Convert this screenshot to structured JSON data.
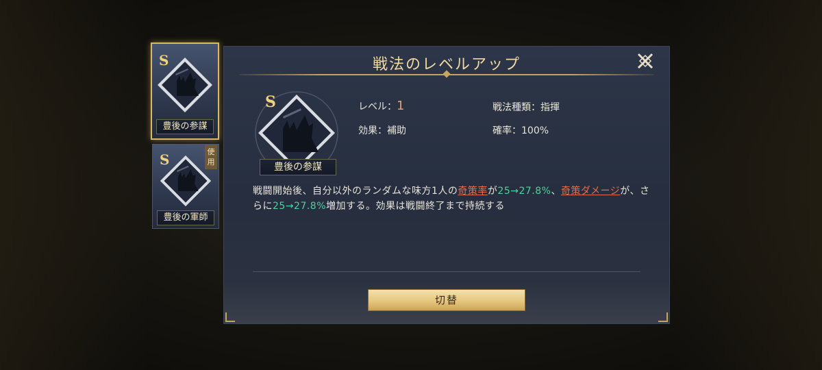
{
  "skill_list": [
    {
      "rank": "S",
      "name": "豊後の参謀",
      "selected": true,
      "badge": ""
    },
    {
      "rank": "S",
      "name": "豊後の軍師",
      "selected": false,
      "badge": "使用"
    }
  ],
  "dialog": {
    "title": "戦法のレベルアップ",
    "close_icon": "close-x-icon",
    "skill": {
      "rank": "S",
      "name": "豊後の参謀"
    },
    "stats": {
      "level_label": "レベル：",
      "level_value": "1",
      "effect_label": "効果：",
      "effect_value": "補助",
      "type_label": "戦法種類：",
      "type_value": "指揮",
      "rate_label": "確率：",
      "rate_value": "100%"
    },
    "description": {
      "p1": "戦闘開始後、自分以外のランダムな味方1人の",
      "hl1": "奇策率",
      "p2": "が",
      "num1": "25→27.8%",
      "p3": "、",
      "hl2": "奇策ダメージ",
      "p4": "が、さらに",
      "num2": "25→27.8%",
      "p5": "増加する。効果は戦闘終了まで持続する"
    },
    "switch_label": "切替"
  },
  "colors": {
    "gold": "#d9b866",
    "highlight_red": "#e66d4b",
    "highlight_green": "#4fd29b",
    "panel_bg": "#2a3244"
  }
}
